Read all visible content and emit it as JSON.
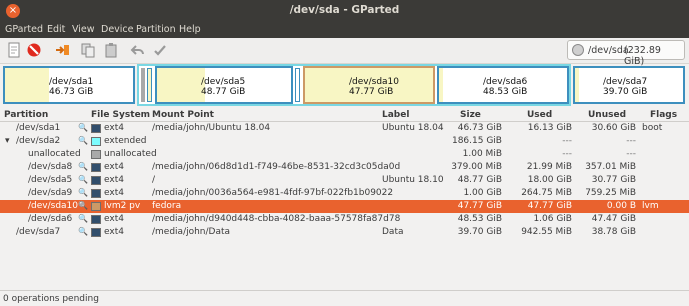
{
  "window": {
    "title": "/dev/sda - GParted",
    "close_glyph": "×"
  },
  "menu": [
    "GParted",
    "Edit",
    "View",
    "Device",
    "Partition",
    "Help"
  ],
  "toolbar": [
    "new-icon",
    "delete-icon",
    "resize-move-icon",
    "copy-icon",
    "paste-icon",
    "undo-icon",
    "apply-icon"
  ],
  "device": {
    "name": "/dev/sda",
    "size": "(232.89 GiB)"
  },
  "diskmap": {
    "partitions": [
      {
        "name": "/dev/sda1",
        "size": "46.73 GiB"
      },
      {
        "name": "/dev/sda5",
        "size": "48.77 GiB"
      },
      {
        "name": "/dev/sda10",
        "size": "47.77 GiB"
      },
      {
        "name": "/dev/sda6",
        "size": "48.53 GiB"
      },
      {
        "name": "/dev/sda7",
        "size": "39.70 GiB"
      }
    ]
  },
  "table": {
    "headers": [
      "Partition",
      "File System",
      "Mount Point",
      "Label",
      "Size",
      "Used",
      "Unused",
      "Flags"
    ],
    "rows": [
      {
        "partition": "/dev/sda1",
        "fs": "ext4",
        "mount": "/media/john/Ubuntu 18.04",
        "label": "Ubuntu 18.04",
        "size": "46.73 GiB",
        "used": "16.13 GiB",
        "unused": "30.60 GiB",
        "flags": "boot",
        "color": "#314e6c",
        "key": true
      },
      {
        "partition": "/dev/sda2",
        "fs": "extended",
        "mount": "",
        "label": "",
        "size": "186.15 GiB",
        "used": "---",
        "unused": "---",
        "flags": "",
        "color": "#7dfcfe",
        "key": false,
        "expander": "▾"
      },
      {
        "partition": "unallocated",
        "fs": "unallocated",
        "mount": "",
        "label": "",
        "size": "1.00 MiB",
        "used": "---",
        "unused": "---",
        "flags": "",
        "color": "#a9a9a9",
        "key": false
      },
      {
        "partition": "/dev/sda8",
        "fs": "ext4",
        "mount": "/media/john/06d8d1d1-f749-46be-8531-32cd3c05da0d",
        "label": "",
        "size": "379.00 MiB",
        "used": "21.99 MiB",
        "unused": "357.01 MiB",
        "flags": "",
        "color": "#314e6c",
        "key": true
      },
      {
        "partition": "/dev/sda5",
        "fs": "ext4",
        "mount": "/",
        "label": "Ubuntu 18.10",
        "size": "48.77 GiB",
        "used": "18.00 GiB",
        "unused": "30.77 GiB",
        "flags": "",
        "color": "#314e6c",
        "key": true
      },
      {
        "partition": "/dev/sda9",
        "fs": "ext4",
        "mount": "/media/john/0036a564-e981-4fdf-97bf-022fb1b09022",
        "label": "",
        "size": "1.00 GiB",
        "used": "264.75 MiB",
        "unused": "759.25 MiB",
        "flags": "",
        "color": "#314e6c",
        "key": true
      },
      {
        "partition": "/dev/sda10",
        "fs": "lvm2 pv",
        "mount": "fedora",
        "label": "",
        "size": "47.77 GiB",
        "used": "47.77 GiB",
        "unused": "0.00 B",
        "flags": "lvm",
        "color": "#cc9966",
        "key": false,
        "selected": true
      },
      {
        "partition": "/dev/sda6",
        "fs": "ext4",
        "mount": "/media/john/d940d448-cbba-4082-baaa-57578fa87d78",
        "label": "",
        "size": "48.53 GiB",
        "used": "1.06 GiB",
        "unused": "47.47 GiB",
        "flags": "",
        "color": "#314e6c",
        "key": true
      },
      {
        "partition": "/dev/sda7",
        "fs": "ext4",
        "mount": "/media/john/Data",
        "label": "Data",
        "size": "39.70 GiB",
        "used": "942.55 MiB",
        "unused": "38.78 GiB",
        "flags": "",
        "color": "#314e6c",
        "key": true
      }
    ]
  },
  "status": {
    "text": "0 operations pending"
  },
  "colors": {
    "accent": "#e9622e",
    "partition_border": "#3d8fbe",
    "extended_border": "#79d7e3",
    "used_fill": "#f8f6c4"
  }
}
